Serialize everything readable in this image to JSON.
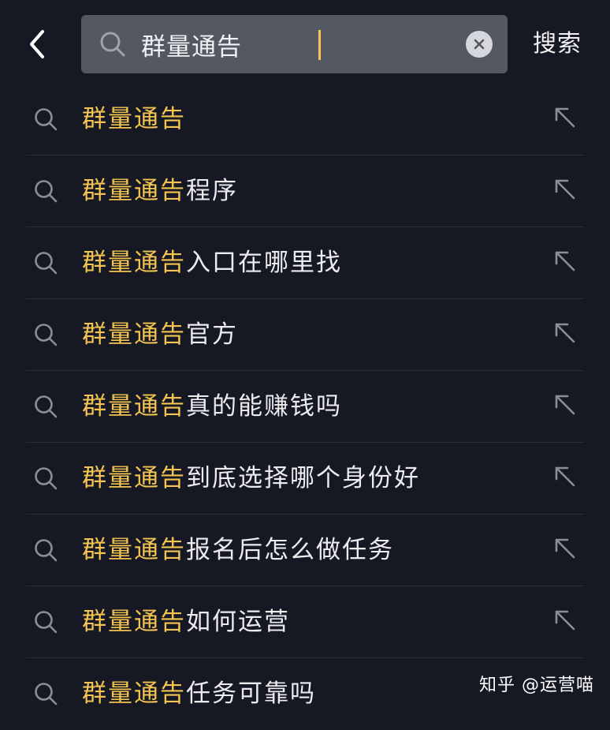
{
  "header": {
    "query": "群量通告",
    "search_label": "搜索"
  },
  "suggestions": [
    {
      "match": "群量通告",
      "rest": ""
    },
    {
      "match": "群量通告",
      "rest": "程序"
    },
    {
      "match": "群量通告",
      "rest": "入口在哪里找"
    },
    {
      "match": "群量通告",
      "rest": "官方"
    },
    {
      "match": "群量通告",
      "rest": "真的能赚钱吗"
    },
    {
      "match": "群量通告",
      "rest": "到底选择哪个身份好"
    },
    {
      "match": "群量通告",
      "rest": "报名后怎么做任务"
    },
    {
      "match": "群量通告",
      "rest": "如何运营"
    },
    {
      "match": "群量通告",
      "rest": "任务可靠吗"
    }
  ],
  "watermark": "知乎 @运营喵",
  "colors": {
    "background": "#161823",
    "search_box": "#545863",
    "highlight": "#f3c451",
    "text": "#ececef"
  },
  "icons": {
    "back": "chevron-left-icon",
    "search": "search-icon",
    "clear": "clear-circle-icon",
    "fill_query": "arrow-up-left-icon"
  }
}
